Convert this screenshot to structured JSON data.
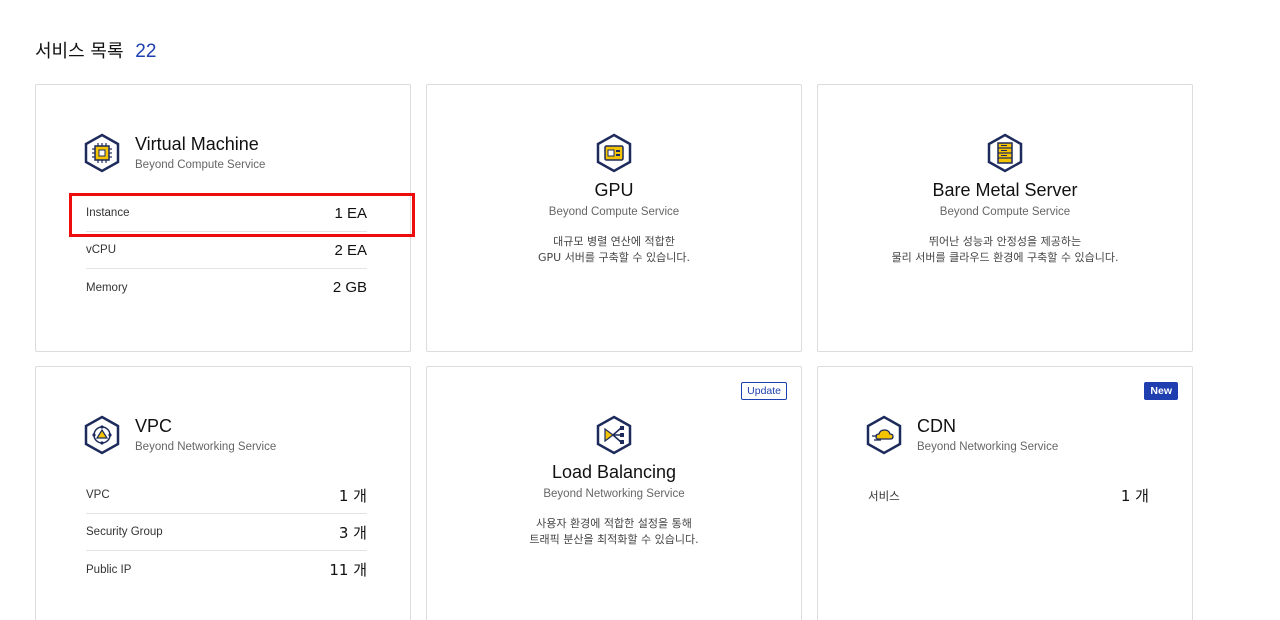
{
  "header": {
    "title": "서비스 목록",
    "count": "22"
  },
  "cards": {
    "vm": {
      "name": "Virtual Machine",
      "subtitle": "Beyond Compute Service",
      "stats": [
        {
          "label": "Instance",
          "value": "1 EA"
        },
        {
          "label": "vCPU",
          "value": "2 EA"
        },
        {
          "label": "Memory",
          "value": "2 GB"
        }
      ]
    },
    "gpu": {
      "name": "GPU",
      "subtitle": "Beyond Compute Service",
      "desc_line1": "대규모 병렬 연산에 적합한",
      "desc_line2": "GPU 서버를 구축할 수 있습니다."
    },
    "bms": {
      "name": "Bare Metal Server",
      "subtitle": "Beyond Compute Service",
      "desc_line1": "뛰어난 성능과 안정성을 제공하는",
      "desc_line2": "물리 서버를 클라우드 환경에 구축할 수 있습니다."
    },
    "vpc": {
      "name": "VPC",
      "subtitle": "Beyond Networking Service",
      "stats": [
        {
          "label": "VPC",
          "value": "1 개"
        },
        {
          "label": "Security Group",
          "value": "3 개"
        },
        {
          "label": "Public IP",
          "value": "11 개"
        }
      ]
    },
    "lb": {
      "name": "Load Balancing",
      "subtitle": "Beyond Networking Service",
      "badge": "Update",
      "desc_line1": "사용자 환경에 적합한 설정을 통해",
      "desc_line2": "트래픽 분산을 최적화할 수 있습니다."
    },
    "cdn": {
      "name": "CDN",
      "subtitle": "Beyond Networking Service",
      "badge": "New",
      "stats": [
        {
          "label": "서비스",
          "value": "1 개"
        }
      ]
    }
  },
  "icons": {
    "vm": "chip-icon",
    "gpu": "gpu-card-icon",
    "bms": "server-rack-icon",
    "vpc": "network-globe-icon",
    "lb": "load-balancer-icon",
    "cdn": "cloud-speed-icon"
  },
  "colors": {
    "accent": "#1f3fb0",
    "icon_yellow": "#f5c400",
    "icon_navy": "#1d2a5c",
    "highlight": "#ee0d0d"
  }
}
